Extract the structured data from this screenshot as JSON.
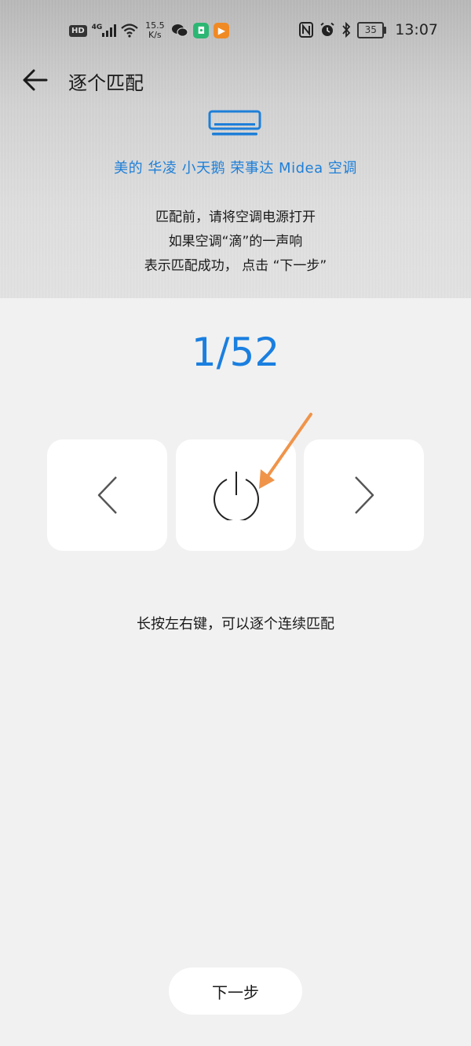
{
  "status_bar": {
    "hd": "HD",
    "network": "4G",
    "speed_value": "15.5",
    "speed_unit": "K/s",
    "battery": "35",
    "time": "13:07",
    "icons": [
      "hd-icon",
      "signal-icon",
      "wifi-icon",
      "wechat-icon",
      "mi-home-icon",
      "video-app-icon",
      "nfc-icon",
      "alarm-icon",
      "bluetooth-icon",
      "battery-icon"
    ]
  },
  "header": {
    "title": "逐个匹配",
    "back_icon": "back-arrow-icon"
  },
  "device": {
    "icon": "air-conditioner-icon",
    "brands": "美的 华凌 小天鹅 荣事达 Midea 空调"
  },
  "instructions": {
    "line1": "匹配前，请将空调电源打开",
    "line2": "如果空调“滴”的一声响",
    "line3": "表示匹配成功， 点击 “下一步”"
  },
  "counter": {
    "text": "1/52"
  },
  "controls": {
    "prev_icon": "chevron-left-icon",
    "power_icon": "power-icon",
    "next_icon": "chevron-right-icon"
  },
  "hint": {
    "text": "长按左右键，可以逐个连续匹配"
  },
  "footer": {
    "next_label": "下一步"
  },
  "colors": {
    "accent": "#1a7fe0",
    "annotation_arrow": "#f0944a",
    "background": "#f1f1f1"
  }
}
